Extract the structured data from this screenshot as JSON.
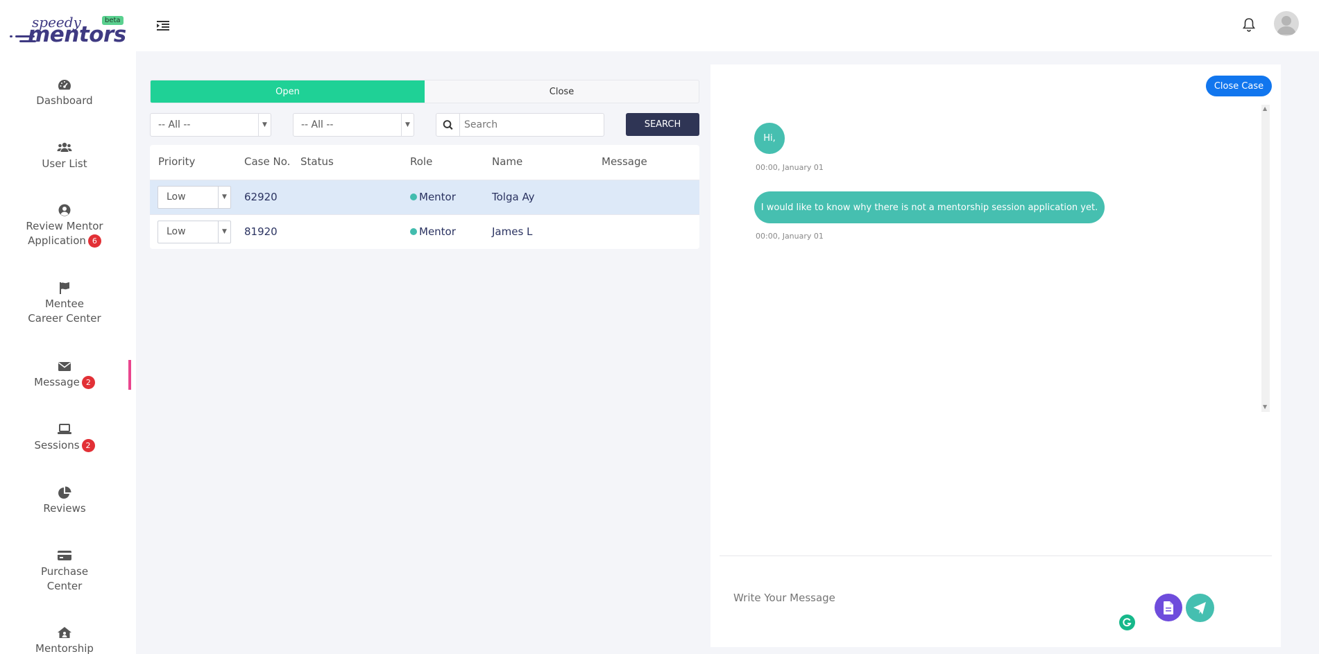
{
  "brand": {
    "line1": "speedy",
    "line2": "mentors",
    "badge": "beta"
  },
  "sidebar": {
    "items": [
      {
        "label": "Dashboard",
        "icon": "dashboard-gauge-icon"
      },
      {
        "label": "User List",
        "icon": "users-icon"
      },
      {
        "label": "Review Mentor Application",
        "badge": "6",
        "icon": "user-circle-icon"
      },
      {
        "label": "Mentee Career Center",
        "icon": "flag-icon"
      },
      {
        "label": "Message",
        "badge": "2",
        "icon": "envelope-icon",
        "active": true
      },
      {
        "label": "Sessions",
        "badge": "2",
        "icon": "laptop-icon"
      },
      {
        "label": "Reviews",
        "icon": "pie-chart-icon"
      },
      {
        "label": "Purchase Center",
        "icon": "credit-card-icon"
      },
      {
        "label": "Mentorship",
        "icon": "house-user-icon"
      }
    ],
    "labels": {
      "review1": "Review Mentor",
      "review2": "Application",
      "mentee1": "Mentee",
      "mentee2": "Career Center",
      "purchase1": "Purchase",
      "purchase2": "Center"
    }
  },
  "tabs": {
    "open": "Open",
    "close": "Close"
  },
  "filters": {
    "select1": "-- All --",
    "select2": "-- All --",
    "search_placeholder": "Search",
    "search_button": "SEARCH"
  },
  "table": {
    "headers": {
      "priority": "Priority",
      "case": "Case No.",
      "status": "Status",
      "role": "Role",
      "name": "Name",
      "message": "Message"
    },
    "rows": [
      {
        "priority": "Low",
        "case": "62920",
        "status": "",
        "role": "Mentor",
        "name": "Tolga Ay",
        "message": ""
      },
      {
        "priority": "Low",
        "case": "81920",
        "status": "",
        "role": "Mentor",
        "name": "James L",
        "message": ""
      }
    ]
  },
  "chat": {
    "close_case": "Close Case",
    "messages": [
      {
        "text": "Hi,",
        "time": "00:00, January 01"
      },
      {
        "text": "I would like to know why there is not a mentorship session application yet.",
        "time": "00:00, January 01"
      }
    ],
    "input_placeholder": "Write Your Message"
  },
  "colors": {
    "accent_green": "#1fd196",
    "bubble_teal": "#46bfb0",
    "brand_purple": "#3f3a82",
    "badge_red": "#e23036",
    "primary_blue": "#1176ee",
    "dark_navy": "#2f3555",
    "active_pink": "#e9458e"
  }
}
